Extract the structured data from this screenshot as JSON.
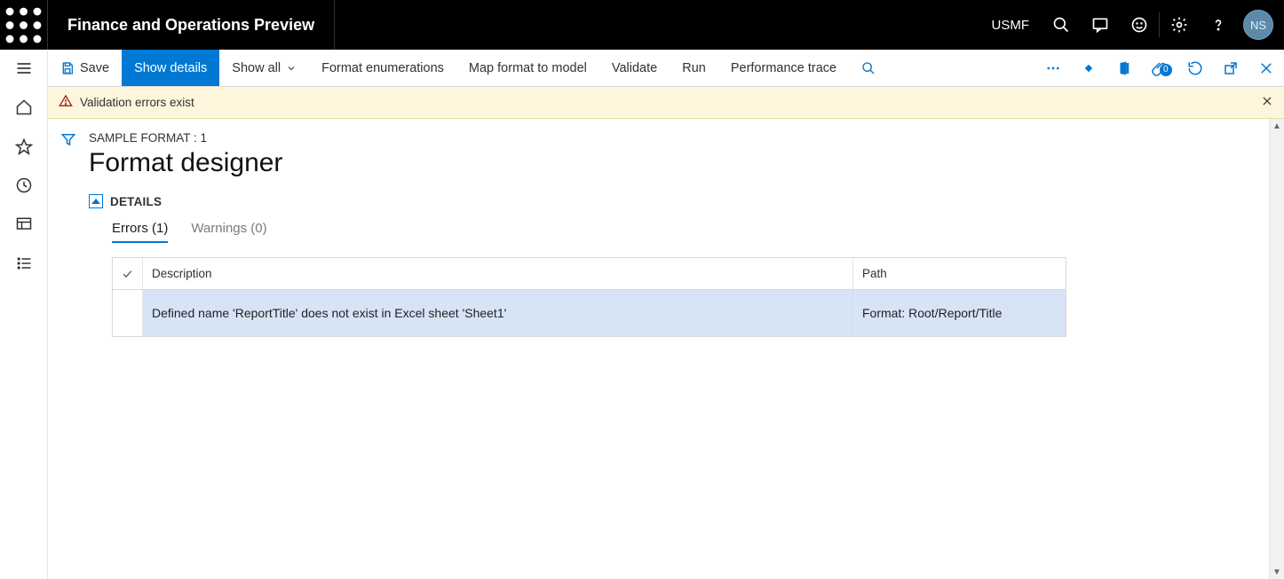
{
  "header": {
    "app_title": "Finance and Operations Preview",
    "entity": "USMF",
    "avatar_initials": "NS"
  },
  "action_bar": {
    "save_label": "Save",
    "show_details_label": "Show details",
    "show_all_label": "Show all",
    "format_enumerations_label": "Format enumerations",
    "map_format_label": "Map format to model",
    "validate_label": "Validate",
    "run_label": "Run",
    "perf_trace_label": "Performance trace",
    "attachment_badge": "0"
  },
  "validation_bar": {
    "message": "Validation errors exist"
  },
  "page": {
    "breadcrumb": "SAMPLE FORMAT : 1",
    "title": "Format designer",
    "details_label": "DETAILS",
    "tabs": {
      "errors": "Errors (1)",
      "warnings": "Warnings (0)"
    },
    "grid": {
      "headers": {
        "description": "Description",
        "path": "Path"
      },
      "row": {
        "description": "Defined name 'ReportTitle' does not exist in Excel sheet 'Sheet1'",
        "path": "Format: Root/Report/Title"
      }
    }
  }
}
